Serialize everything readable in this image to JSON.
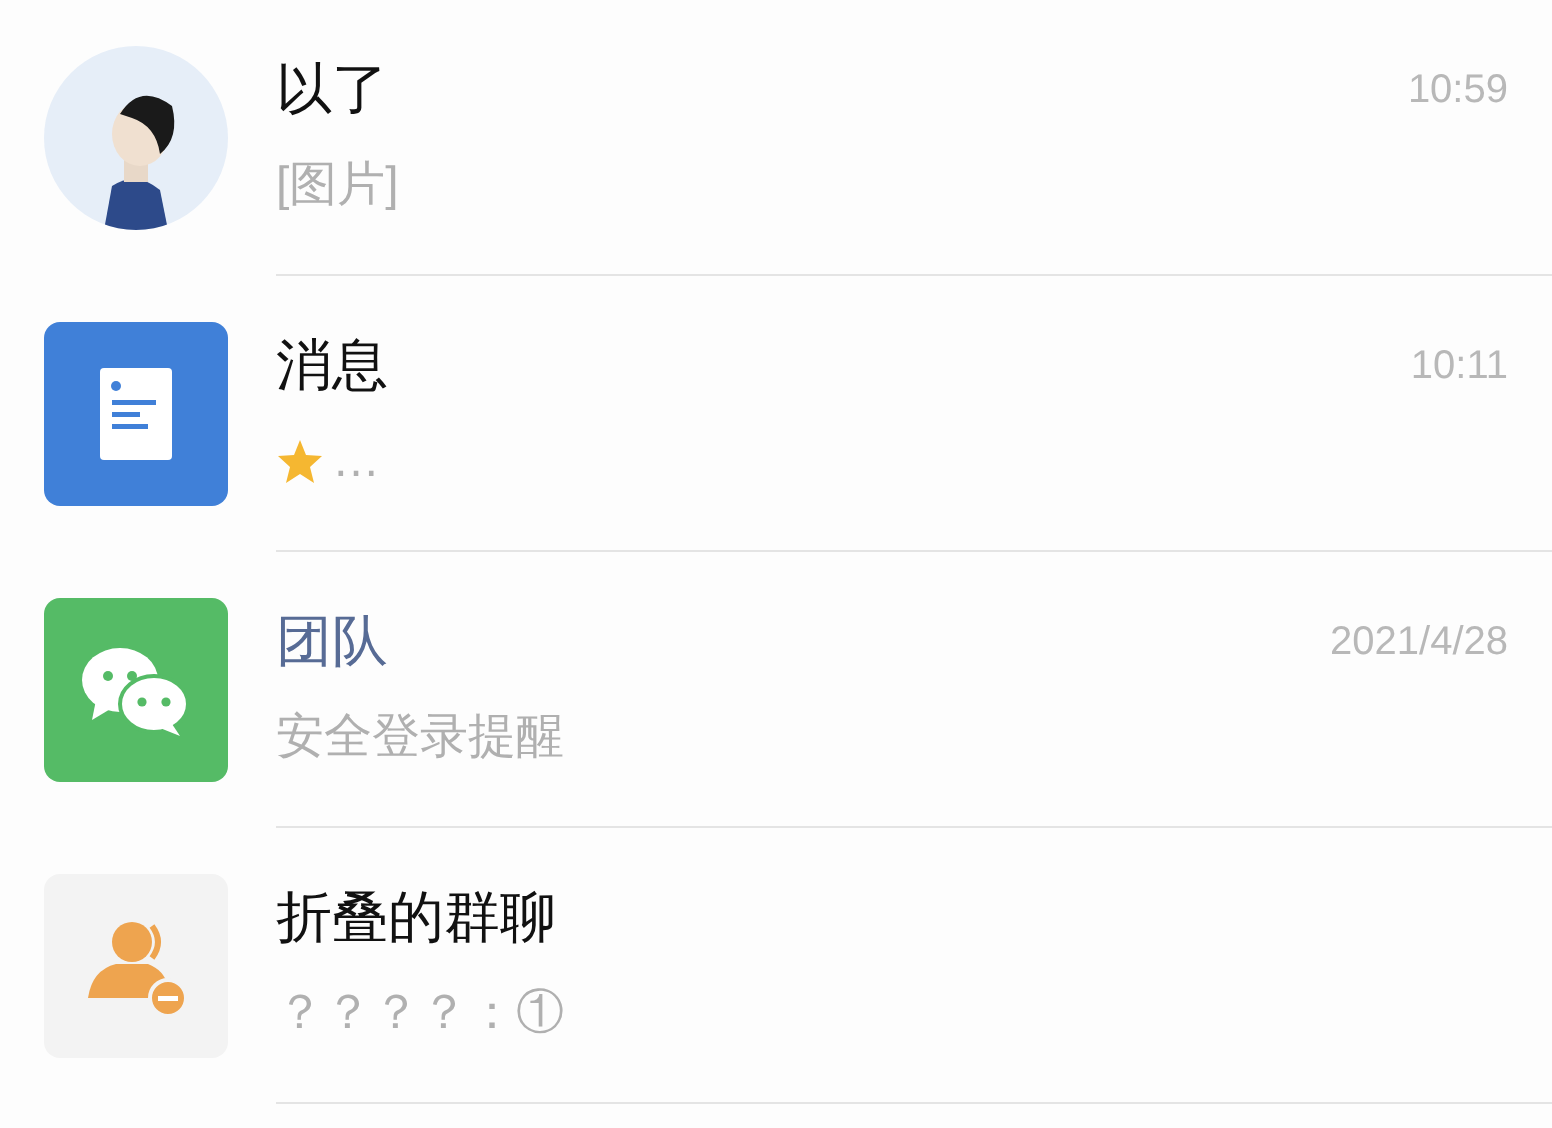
{
  "chats": [
    {
      "kind": "picture",
      "title": "以了",
      "title_link": false,
      "time": "10:59",
      "starred": false,
      "preview": "[图片]"
    },
    {
      "kind": "document",
      "title": "消息",
      "title_link": false,
      "time": "10:11",
      "starred": true,
      "preview": "…"
    },
    {
      "kind": "chat",
      "title": "团队",
      "title_link": true,
      "time": "2021/4/28",
      "starred": false,
      "preview": "安全登录提醒"
    },
    {
      "kind": "folded",
      "title": "折叠的群聊",
      "title_link": false,
      "starred": false,
      "preview": "？？？？：①"
    }
  ]
}
